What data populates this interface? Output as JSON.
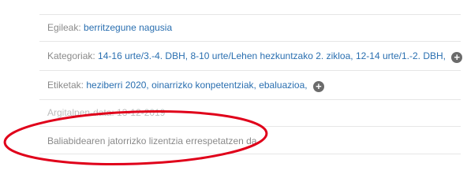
{
  "author": {
    "label": "Egileak:",
    "value": "berritzegune nagusia"
  },
  "categories": {
    "label": "Kategoriak:",
    "items": [
      "14-16 urte/3.-4. DBH,",
      "8-10 urte/Lehen hezkuntzako 2. zikloa,",
      "12-14 urte/1.-2. DBH,"
    ],
    "more_icon": "plus-circle-icon"
  },
  "tags": {
    "label": "Etiketak:",
    "items": [
      "heziberri 2020,",
      "oinarrizko konpetentziak,",
      "ebaluazioa,"
    ],
    "more_icon": "plus-circle-icon"
  },
  "publish_date": {
    "text": "Argitalpen-data: 13-12-2019"
  },
  "license": {
    "text": "Baliabidearen jatorrizko lizentzia errespetatzen da."
  },
  "colors": {
    "link": "#2a6fb0",
    "highlight": "#e0001a"
  }
}
